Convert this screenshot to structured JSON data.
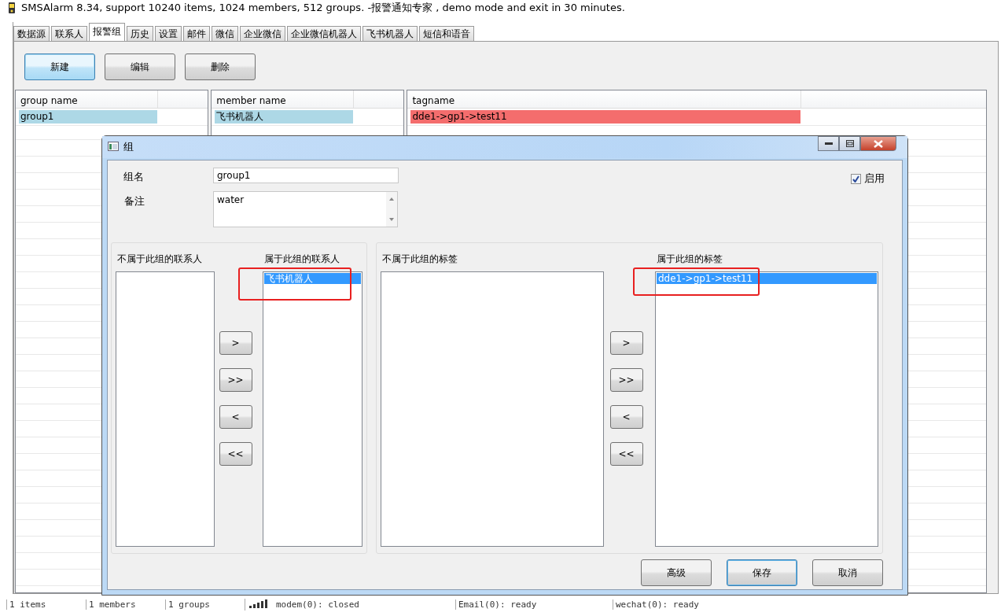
{
  "window": {
    "title": "SMSAlarm 8.34, support 10240 items, 1024 members, 512 groups. -报警通知专家 , demo mode and exit in 30 minutes."
  },
  "tabs": [
    {
      "label": "数据源",
      "selected": false
    },
    {
      "label": "联系人",
      "selected": false
    },
    {
      "label": "报警组",
      "selected": true
    },
    {
      "label": "历史",
      "selected": false
    },
    {
      "label": "设置",
      "selected": false
    },
    {
      "label": "邮件",
      "selected": false
    },
    {
      "label": "微信",
      "selected": false
    },
    {
      "label": "企业微信",
      "selected": false
    },
    {
      "label": "企业微信机器人",
      "selected": false
    },
    {
      "label": "飞书机器人",
      "selected": false
    },
    {
      "label": "短信和语音",
      "selected": false
    }
  ],
  "toolbar": [
    {
      "label": "新建",
      "focused": true
    },
    {
      "label": "编辑",
      "focused": false
    },
    {
      "label": "删除",
      "focused": false
    }
  ],
  "tables": [
    {
      "column": "group name",
      "rows": [
        {
          "text": "group1",
          "color": "#add8e6"
        }
      ]
    },
    {
      "column": "member name",
      "rows": [
        {
          "text": "飞书机器人",
          "color": "#add8e6"
        }
      ]
    },
    {
      "column": "tagname",
      "rows": [
        {
          "text": "dde1->gp1->test11",
          "color": "#f46d6d"
        }
      ]
    }
  ],
  "dialog": {
    "title": "组",
    "group_name": {
      "label": "组名",
      "value": "group1"
    },
    "note": {
      "label": "备注",
      "value": "water"
    },
    "enabled": {
      "label": "启用",
      "checked": true
    },
    "sections": [
      {
        "available_label": "不属于此组的联系人",
        "members_label": "属于此组的联系人",
        "members": [
          {
            "text": "飞书机器人",
            "selected": true
          }
        ],
        "move_buttons": [
          ">",
          ">>",
          "<",
          "<<"
        ],
        "highlighted": true
      },
      {
        "available_label": "不属于此组的标签",
        "members_label": "属于此组的标签",
        "members": [
          {
            "text": "dde1->gp1->test11",
            "selected": true
          }
        ],
        "move_buttons": [
          ">",
          ">>",
          "<",
          "<<"
        ],
        "highlighted": true
      }
    ],
    "buttons": [
      {
        "label": "高级",
        "default": false
      },
      {
        "label": "保存",
        "default": true
      },
      {
        "label": "取消",
        "default": false
      }
    ]
  },
  "status_bar": [
    "1 items",
    "1 members",
    "1 groups",
    "modem(0): closed",
    "Email(0): ready",
    "wechat(0): ready"
  ]
}
